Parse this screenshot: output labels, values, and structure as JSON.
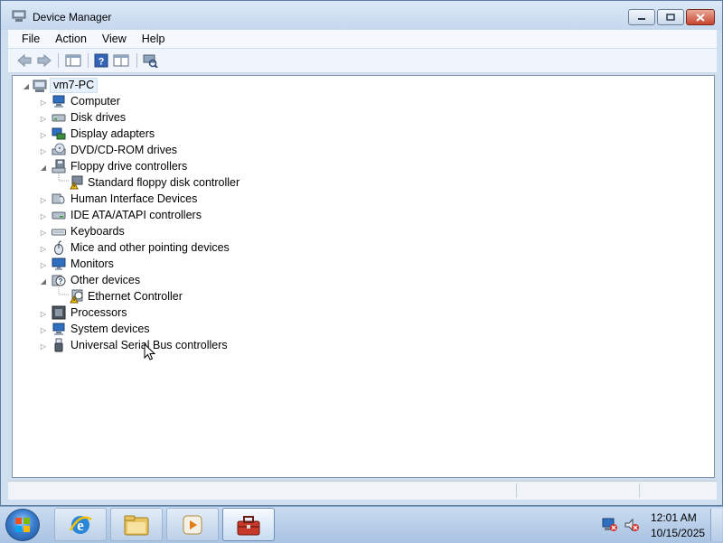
{
  "window": {
    "title": "Device Manager",
    "controls": [
      "minimize",
      "maximize",
      "close"
    ]
  },
  "menu": [
    "File",
    "Action",
    "View",
    "Help"
  ],
  "toolbar": {
    "buttons": [
      "back-icon",
      "forward-icon",
      "show-hide-console-tree-icon",
      "help-icon",
      "properties-icon",
      "scan-hardware-icon"
    ]
  },
  "tree": {
    "root": "vm7-PC",
    "items": [
      {
        "label": "Computer",
        "icon": "computer-icon",
        "expanded": false
      },
      {
        "label": "Disk drives",
        "icon": "disk-drive-icon",
        "expanded": false
      },
      {
        "label": "Display adapters",
        "icon": "display-adapter-icon",
        "expanded": false
      },
      {
        "label": "DVD/CD-ROM drives",
        "icon": "dvd-drive-icon",
        "expanded": false
      },
      {
        "label": "Floppy drive controllers",
        "icon": "floppy-controller-icon",
        "expanded": true,
        "children": [
          {
            "label": "Standard floppy disk controller",
            "icon": "floppy-warning-icon"
          }
        ]
      },
      {
        "label": "Human Interface Devices",
        "icon": "hid-icon",
        "expanded": false
      },
      {
        "label": "IDE ATA/ATAPI controllers",
        "icon": "ide-controller-icon",
        "expanded": false
      },
      {
        "label": "Keyboards",
        "icon": "keyboard-icon",
        "expanded": false
      },
      {
        "label": "Mice and other pointing devices",
        "icon": "mouse-icon",
        "expanded": false
      },
      {
        "label": "Monitors",
        "icon": "monitor-icon",
        "expanded": false
      },
      {
        "label": "Other devices",
        "icon": "other-devices-icon",
        "expanded": true,
        "children": [
          {
            "label": "Ethernet Controller",
            "icon": "unknown-device-warning-icon"
          }
        ]
      },
      {
        "label": "Processors",
        "icon": "processor-icon",
        "expanded": false
      },
      {
        "label": "System devices",
        "icon": "system-devices-icon",
        "expanded": false
      },
      {
        "label": "Universal Serial Bus controllers",
        "icon": "usb-icon",
        "expanded": false
      }
    ]
  },
  "taskbar": {
    "pinned": [
      "internet-explorer-icon",
      "windows-explorer-icon",
      "media-player-icon",
      "device-manager-toolbox-icon"
    ],
    "active": "device-manager-toolbox-icon"
  },
  "clock": {
    "time": "12:01 AM",
    "date": "10/15/2025"
  },
  "colors": {
    "accent": "#3b7fd0",
    "selection": "#e5f0fb",
    "warning": "#f2c200"
  }
}
